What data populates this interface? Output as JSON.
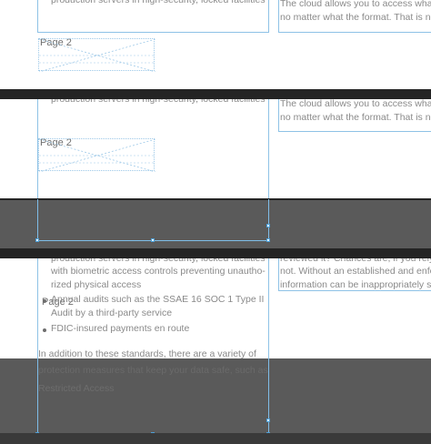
{
  "panel1": {
    "left_text": "production servers in high-security, locked facilities",
    "right_line1": "The cloud allows you to access what",
    "right_line2": "no matter what the format. That is no",
    "page_label": "Page 2"
  },
  "panel2": {
    "left_text": "production servers in high-security, locked facilities",
    "right_line1": "The cloud allows you to access what",
    "right_line2": "no matter what the format. That is no",
    "page_label": "Page 2"
  },
  "panel3": {
    "left_lines": [
      "production servers in high-security, locked facilities",
      "with biometric access controls preventing unautho-",
      "rized physical access"
    ],
    "page_label": "Page 2",
    "bullets": [
      "Annual audits such as the SSAE 16 SOC 1 Type II",
      "Audit by a third-party service",
      "FDIC-insured payments en route"
    ],
    "paragraph": "In addition to these standards, there are a variety of",
    "faded_line1": "protection measures that keep your data safe, such as",
    "faded_heading": "Restricted Access",
    "right_lines": [
      "reviewed it? Chances are, if you rely",
      "not. Without an established and enfo",
      "information can be inappropriately s"
    ]
  }
}
